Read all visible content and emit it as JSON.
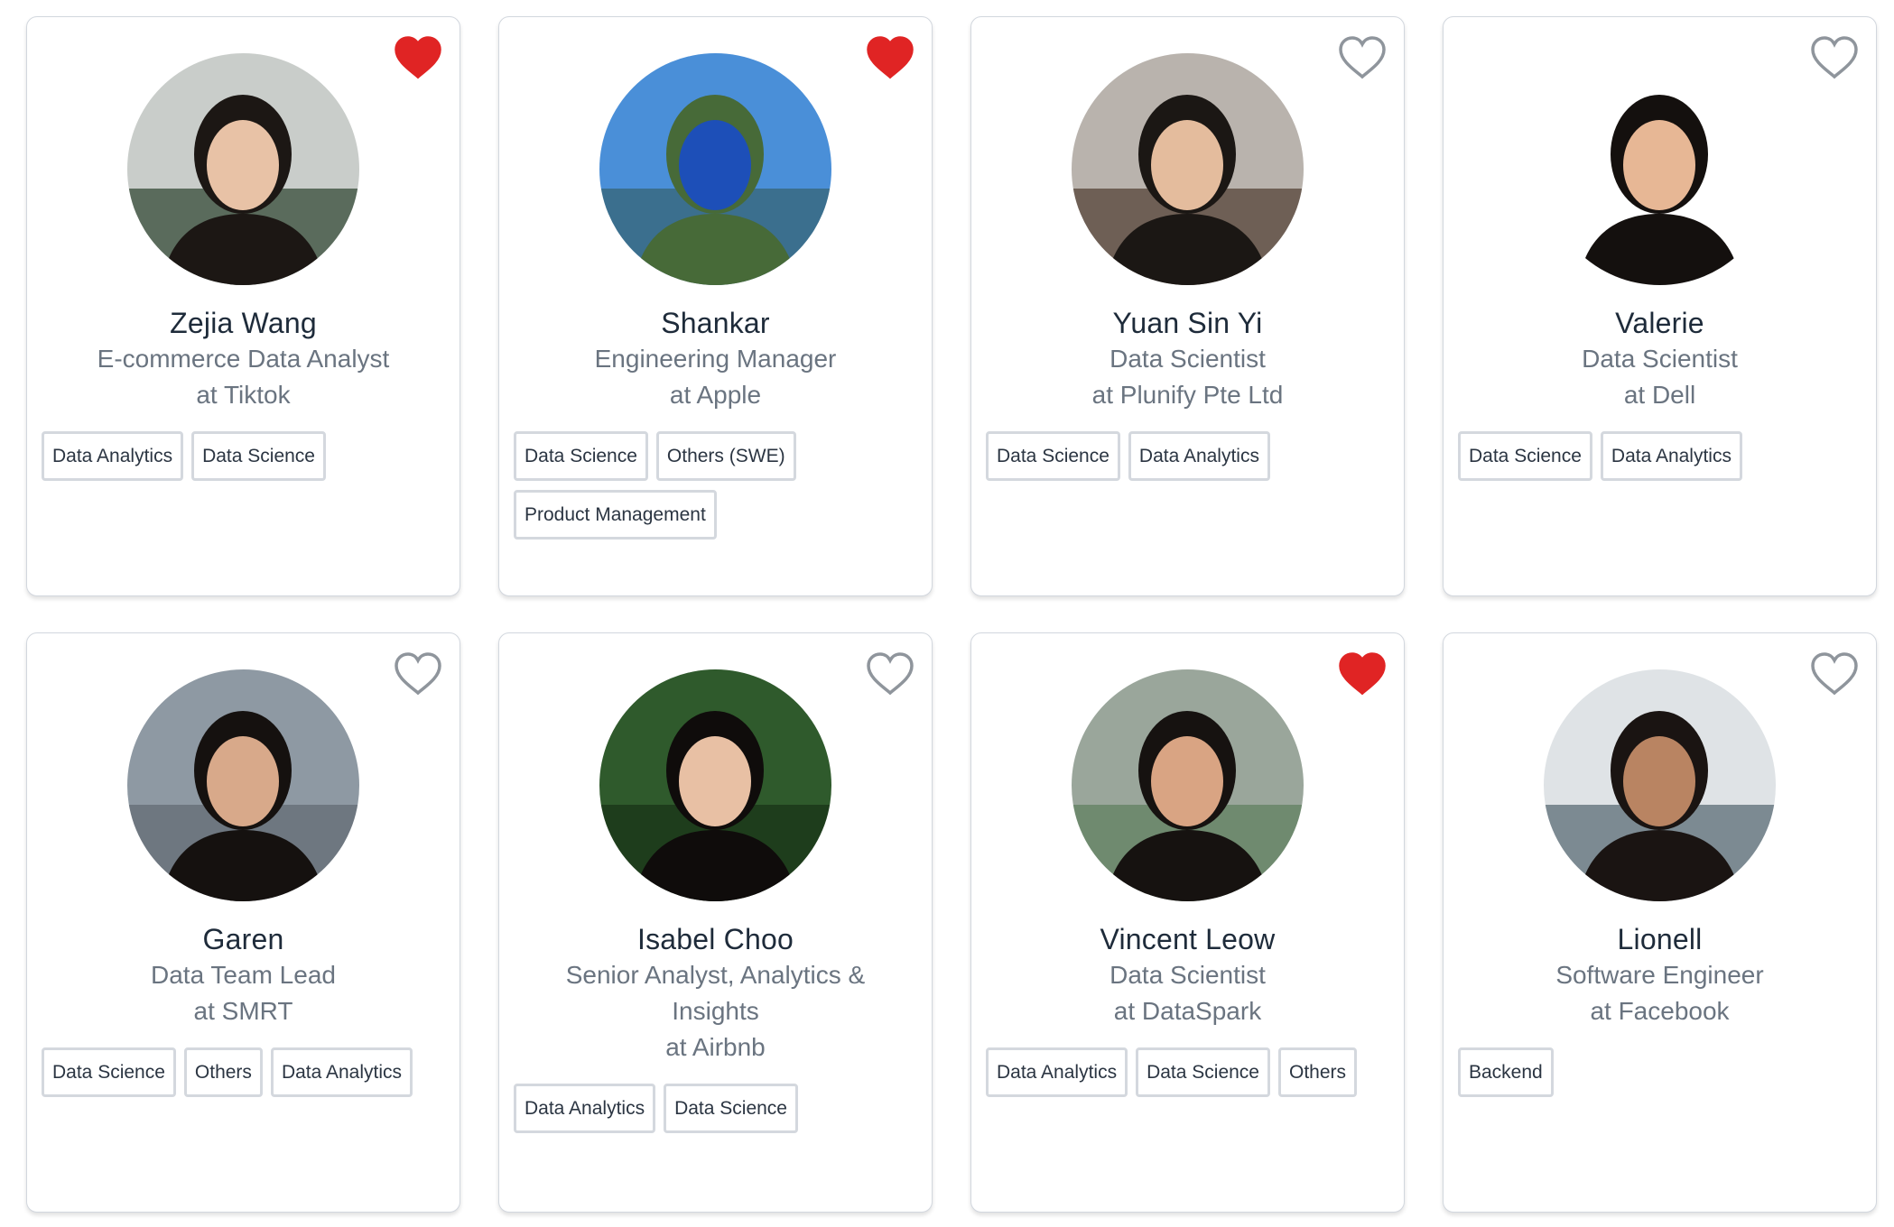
{
  "colors": {
    "heart_filled": "#e02424",
    "heart_outline": "#8f959c",
    "card_border": "#d2d7de",
    "tag_border": "#d4d8de",
    "name_text": "#1e2b3a",
    "subtitle_text": "#6a7480"
  },
  "mentors": [
    {
      "name": "Zejia Wang",
      "role": "E-commerce Data Analyst",
      "company": "at Tiktok",
      "favorited": true,
      "heart_icon": "heart-filled-icon",
      "photo_palette": [
        "#c9cdca",
        "#5a6b5c",
        "#1c1714",
        "#e8c2a6"
      ],
      "tags": [
        "Data Analytics",
        "Data Science"
      ]
    },
    {
      "name": "Shankar",
      "role": "Engineering Manager",
      "company": "at Apple",
      "favorited": true,
      "heart_icon": "heart-filled-icon",
      "photo_palette": [
        "#4a8fd8",
        "#3b6f8e",
        "#476a38",
        "#1d4fb8"
      ],
      "tags": [
        "Data Science",
        "Others (SWE)",
        "Product Management"
      ]
    },
    {
      "name": "Yuan Sin Yi",
      "role": "Data Scientist",
      "company": "at Plunify Pte Ltd",
      "favorited": false,
      "heart_icon": "heart-outline-icon",
      "photo_palette": [
        "#b9b3ad",
        "#6e5f55",
        "#1b1714",
        "#e4bc9d"
      ],
      "tags": [
        "Data Science",
        "Data Analytics"
      ]
    },
    {
      "name": "Valerie",
      "role": "Data Scientist",
      "company": "at Dell",
      "favorited": false,
      "heart_icon": "heart-outline-icon",
      "photo_palette": [
        "#ffffff",
        "#ffffff",
        "#14100e",
        "#e7b795"
      ],
      "tags": [
        "Data Science",
        "Data Analytics"
      ]
    },
    {
      "name": "Garen",
      "role": "Data Team Lead",
      "company": "at SMRT",
      "favorited": false,
      "heart_icon": "heart-outline-icon",
      "photo_palette": [
        "#8e99a3",
        "#6e7780",
        "#15110f",
        "#d8a98a"
      ],
      "tags": [
        "Data Science",
        "Others",
        "Data Analytics"
      ]
    },
    {
      "name": "Isabel Choo",
      "role": "Senior Analyst, Analytics & Insights",
      "company": "at Airbnb",
      "favorited": false,
      "heart_icon": "heart-outline-icon",
      "photo_palette": [
        "#2f5a2c",
        "#1e3d1c",
        "#0f0c0b",
        "#e8c0a4"
      ],
      "tags": [
        "Data Analytics",
        "Data Science"
      ]
    },
    {
      "name": "Vincent Leow",
      "role": "Data Scientist",
      "company": "at DataSpark",
      "favorited": true,
      "heart_icon": "heart-filled-icon",
      "photo_palette": [
        "#9aa69b",
        "#6f8a6f",
        "#161210",
        "#d9a483"
      ],
      "tags": [
        "Data Analytics",
        "Data Science",
        "Others"
      ]
    },
    {
      "name": "Lionell",
      "role": "Software Engineer",
      "company": "at Facebook",
      "favorited": false,
      "heart_icon": "heart-outline-icon",
      "photo_palette": [
        "#dfe3e6",
        "#7c8a92",
        "#1a1412",
        "#b98462"
      ],
      "tags": [
        "Backend"
      ]
    }
  ]
}
